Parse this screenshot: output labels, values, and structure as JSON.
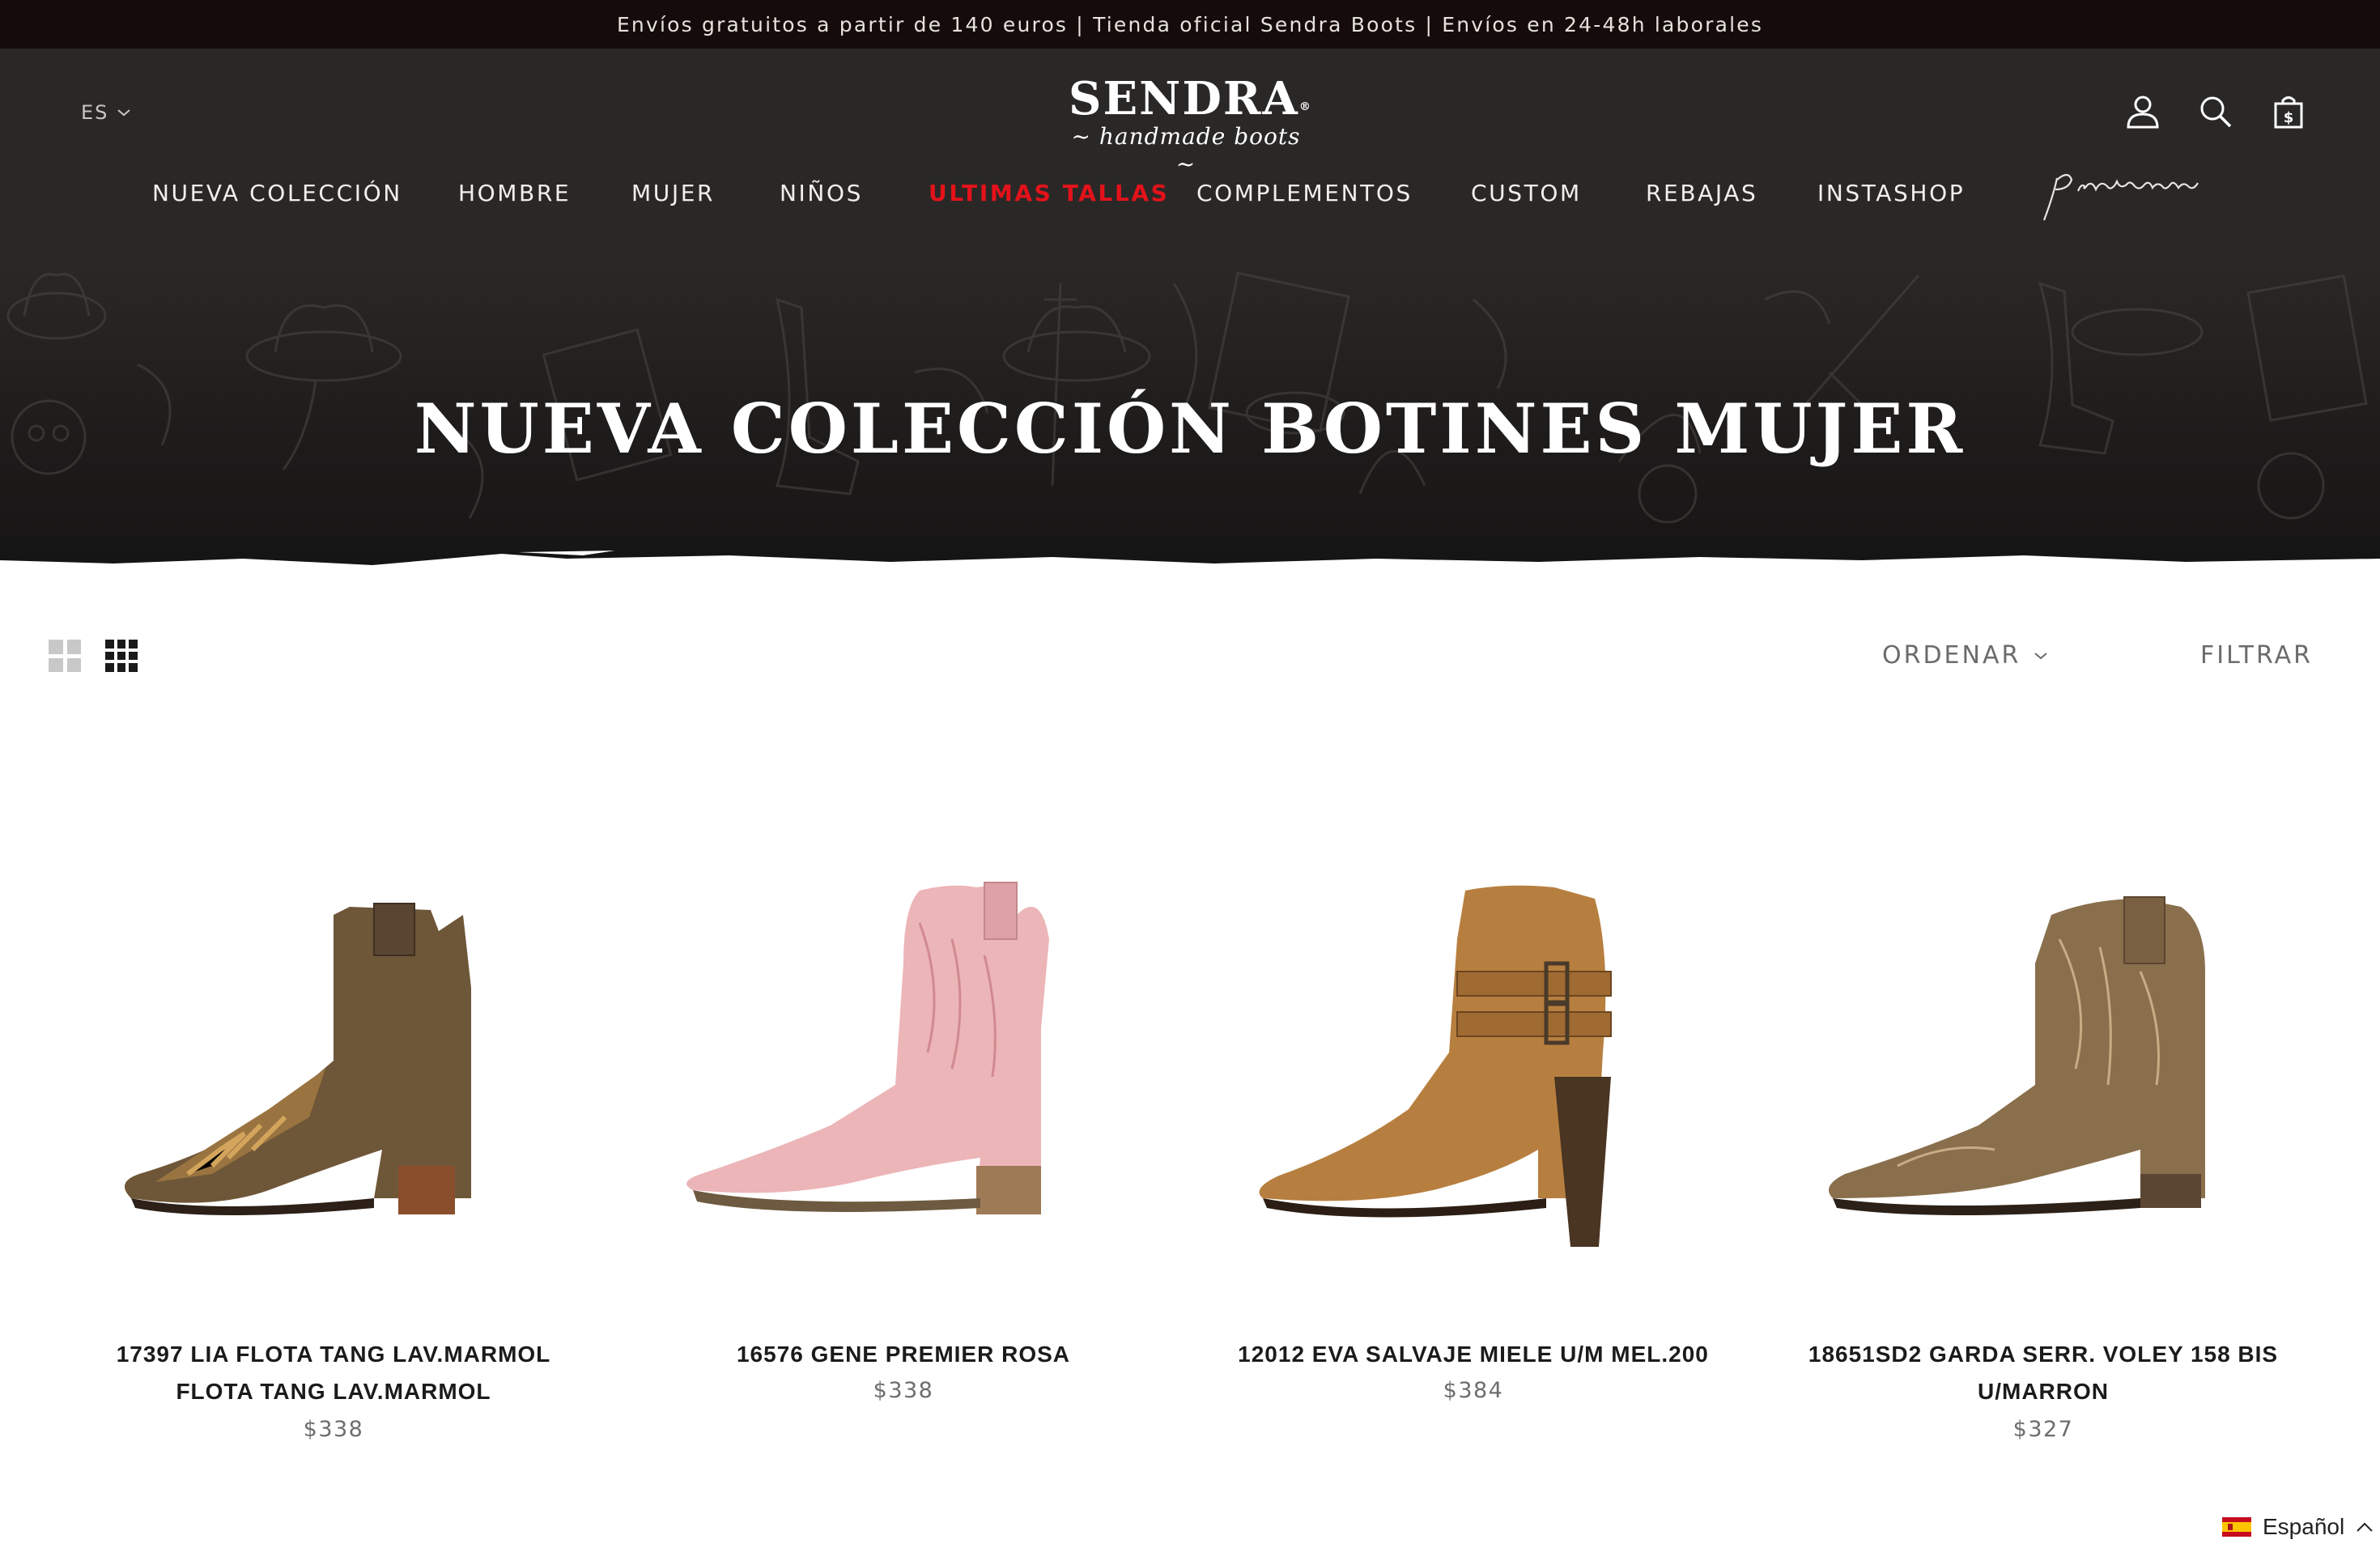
{
  "announcement": "Envíos gratuitos a partir de 140 euros | Tienda oficial Sendra Boots | Envíos en 24-48h laborales",
  "header": {
    "language": "ES",
    "logo": {
      "brand": "SENDRA",
      "registered": "®",
      "tagline": "~ handmade boots ~"
    },
    "icons": [
      "account-icon",
      "search-icon",
      "cart-icon"
    ]
  },
  "nav": {
    "items": [
      {
        "label": "NUEVA COLECCIÓN"
      },
      {
        "label": "HOMBRE"
      },
      {
        "label": "MUJER"
      },
      {
        "label": "NIÑOS"
      },
      {
        "label": "ULTIMAS TALLAS",
        "highlight": true
      },
      {
        "label": "COMPLEMENTOS"
      },
      {
        "label": "CUSTOM"
      },
      {
        "label": "REBAJAS"
      },
      {
        "label": "INSTASHOP"
      }
    ],
    "premium": "premium"
  },
  "hero": {
    "title": "NUEVA COLECCIÓN BOTINES MUJER"
  },
  "toolbar": {
    "sort_label": "ORDENAR",
    "filter_label": "FILTRAR"
  },
  "products": [
    {
      "name": "17397 LIA FLOTA TANG LAV.MARMOL FLOTA TANG LAV.MARMOL",
      "price": "$338"
    },
    {
      "name": "16576 GENE PREMIER ROSA",
      "price": "$338"
    },
    {
      "name": "12012 EVA SALVAJE MIELE U/M MEL.200",
      "price": "$384"
    },
    {
      "name": "18651SD2 GARDA SERR. VOLEY 158 BIS U/MARRON",
      "price": "$327"
    }
  ],
  "language_switcher": {
    "label": "Español"
  },
  "colors": {
    "accent_red": "#e3121a",
    "header_bg": "#2a2827",
    "announce_bg": "#140b0a"
  }
}
